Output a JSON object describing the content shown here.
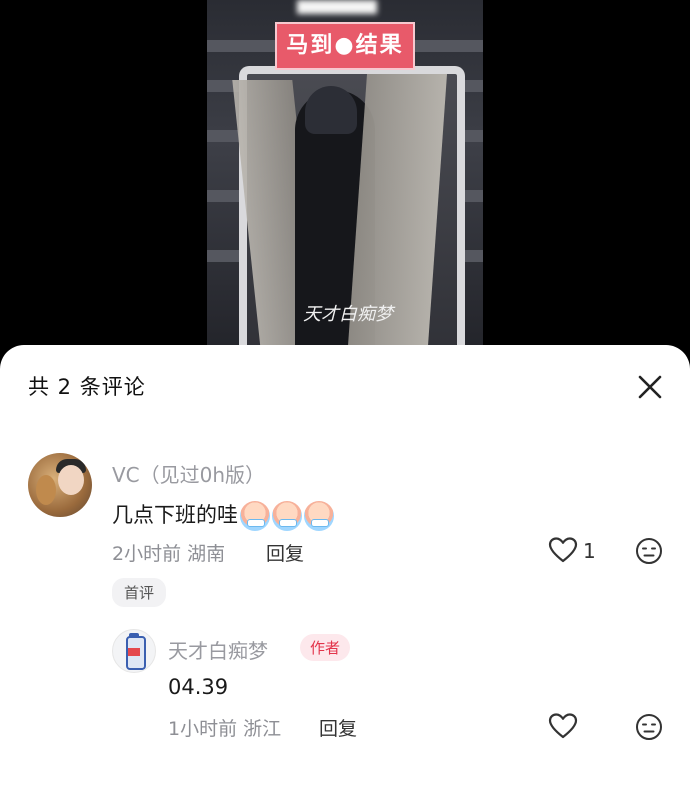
{
  "video": {
    "sign_text": "马到●结果",
    "watermark": "天才白痴梦"
  },
  "sheet": {
    "title": "共 2 条评论"
  },
  "comments": [
    {
      "username": "VC（见过0h版）",
      "text": "几点下班的哇",
      "time": "2小时前",
      "location": "湖南",
      "reply_label": "回复",
      "like_count": "1",
      "badge": "首评"
    }
  ],
  "replies": [
    {
      "username": "天才白痴梦",
      "author_badge": "作者",
      "text": "04.39",
      "time": "1小时前",
      "location": "浙江",
      "reply_label": "回复"
    }
  ],
  "icons": {
    "close": "close-icon",
    "like": "heart-icon",
    "dislike": "meh-face-icon"
  },
  "colors": {
    "author_badge_text": "#e3344b",
    "author_badge_bg": "#fde8ec",
    "meta_text": "#8e8f95"
  }
}
